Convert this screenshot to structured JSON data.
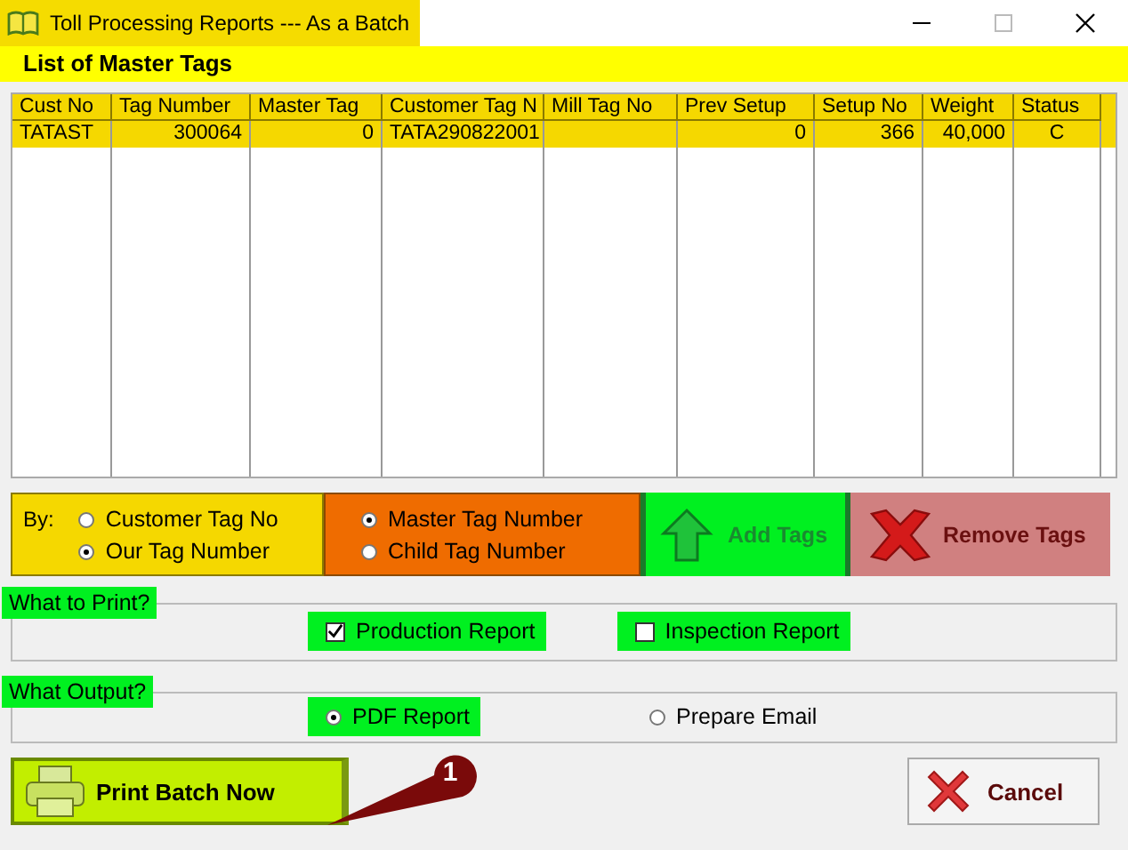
{
  "window": {
    "title": "Toll Processing Reports --- As a Batch"
  },
  "header": "List of Master Tags",
  "table": {
    "columns": [
      "Cust No",
      "Tag Number",
      "Master Tag",
      "Customer Tag N",
      "Mill Tag No",
      "Prev Setup",
      "Setup No",
      "Weight",
      "Status"
    ],
    "rows": [
      {
        "cells": [
          "TATAST",
          "300064",
          "0",
          "TATA290822001",
          "",
          "0",
          "366",
          "40,000",
          "C"
        ],
        "selected": true
      }
    ]
  },
  "by_group": {
    "label": "By:",
    "options": [
      {
        "label": "Customer Tag No",
        "selected": false
      },
      {
        "label": "Our Tag Number",
        "selected": true
      }
    ]
  },
  "tag_group": {
    "options": [
      {
        "label": "Master Tag Number",
        "selected": true
      },
      {
        "label": "Child Tag Number",
        "selected": false
      }
    ]
  },
  "add_button": "Add Tags",
  "remove_button": "Remove Tags",
  "print_group": {
    "title": "What to Print?",
    "options": [
      {
        "label": "Production Report",
        "checked": true,
        "highlighted": true
      },
      {
        "label": "Inspection Report",
        "checked": false,
        "highlighted": true
      }
    ]
  },
  "output_group": {
    "title": "What Output?",
    "options": [
      {
        "label": "PDF Report",
        "selected": true,
        "highlighted": true
      },
      {
        "label": "Prepare Email",
        "selected": false,
        "highlighted": false
      }
    ]
  },
  "print_button": "Print Batch Now",
  "cancel_button": "Cancel",
  "callout": "1"
}
